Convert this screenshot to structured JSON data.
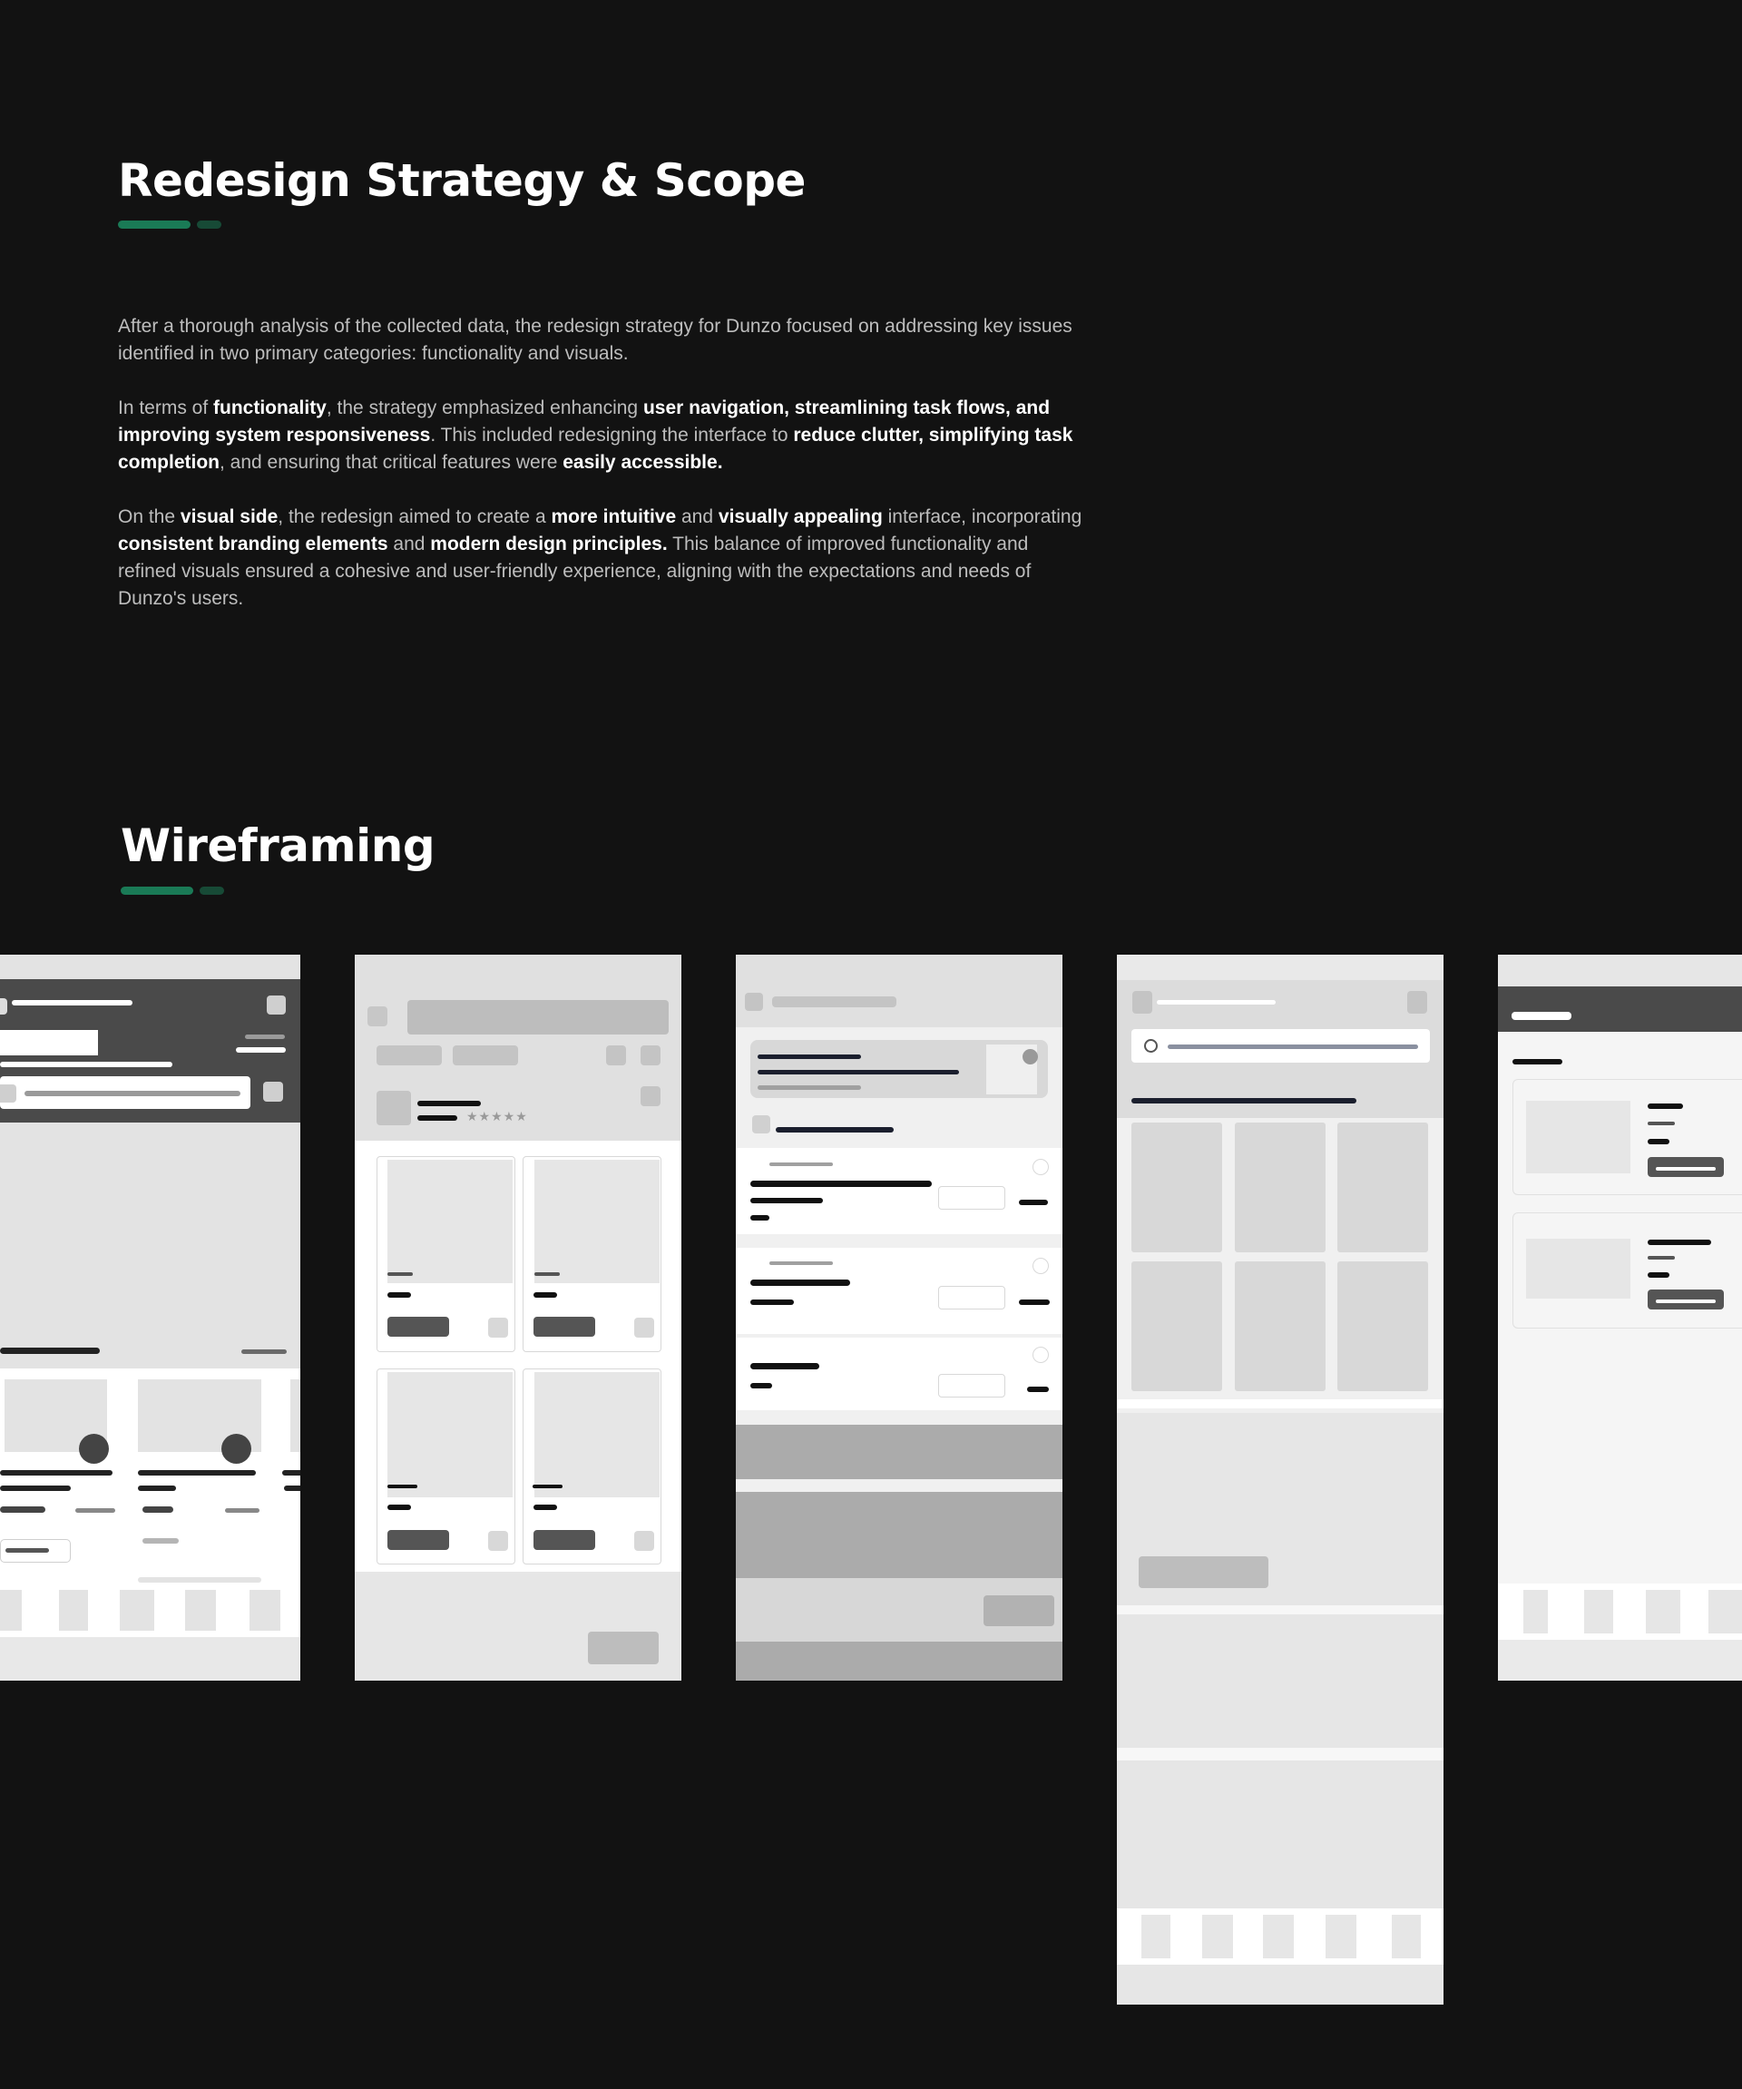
{
  "colors": {
    "background": "#121212",
    "accent": "#1a7a56",
    "accent_dark": "#174a36"
  },
  "strategy": {
    "title": "Redesign Strategy & Scope",
    "p1": "After a thorough analysis of the collected data, the redesign strategy for Dunzo focused on addressing key issues identified in two primary categories: functionality and visuals.",
    "p2": {
      "t1": "In terms of ",
      "b1": "functionality",
      "t2": ", the strategy emphasized enhancing ",
      "b2": "user navigation, streamlining task flows, and improving system responsiveness",
      "t3": ". This included redesigning the interface to ",
      "b3": "reduce clutter, simplifying task completion",
      "t4": ", and ensuring that critical features were ",
      "b4": "easily accessible."
    },
    "p3": {
      "t1": "On the ",
      "b1": "visual side",
      "t2": ", the redesign aimed to create a ",
      "b2": "more intuitive",
      "t3": " and ",
      "b3": "visually appealing",
      "t4": " interface, incorporating ",
      "b4": "consistent branding elements",
      "t5": " and ",
      "b5": "modern design principles.",
      "t6": " This balance of improved functionality and refined visuals ensured a cohesive and user-friendly experience, aligning with the expectations and needs of Dunzo's users."
    }
  },
  "wireframing": {
    "title": "Wireframing",
    "stars": "★★★★★"
  }
}
